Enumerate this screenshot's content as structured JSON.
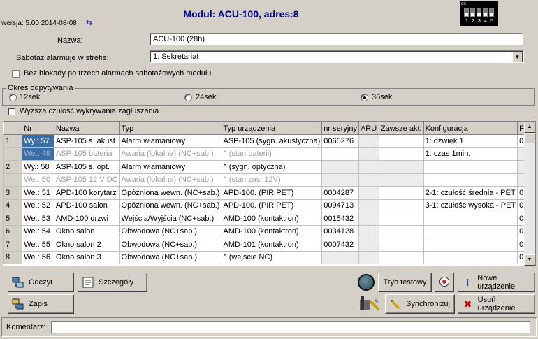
{
  "header": {
    "title": "Moduł: ACU-100, adres:8",
    "version": "wersja: 5.00 2014-08-08",
    "dip_label": "on",
    "dip_numbers": [
      "1",
      "2",
      "3",
      "4",
      "5"
    ]
  },
  "form": {
    "name_label": "Nazwa:",
    "name_value": "ACU-100   (28h)",
    "zone_label": "Sabotaż alarmuje w strefie:",
    "zone_value": "1: Sekretariat",
    "no_block_label": "Bez blokady po trzech alarmach sabotażowych modułu",
    "poll_group_label": "Okres odpytywania",
    "poll_options": [
      "12sek.",
      "24sek.",
      "36sek."
    ],
    "poll_selected": "36sek.",
    "jamming_label": "Wyższa czułość wykrywania zagłuszania"
  },
  "table": {
    "columns": [
      "",
      "Nr",
      "Nazwa",
      "Typ",
      "Typ urządzenia",
      "nr seryjny",
      "ARU",
      "Zawsze akt.",
      "Konfiguracja",
      "Filtr"
    ],
    "rows": [
      {
        "idx": "1",
        "nr": "Wy.: 57",
        "name": "ASP-105 s. akust",
        "type": "Alarm włamaniowy",
        "device": "ASP-105 (sygn. akustyczna)",
        "serial": "0065276",
        "aru": "",
        "always": "",
        "config": "1: dźwięk 1",
        "filter": "0"
      },
      {
        "idx": "",
        "nr": "We.: 49",
        "name": "ASP-105 bateria",
        "type": "Awaria (lokalna) (NC+sab.)",
        "device": "^                (stan baterii)",
        "serial": "",
        "aru": "",
        "always": "",
        "config": "1: czas 1min.",
        "filter": ""
      },
      {
        "idx": "2",
        "nr": "Wy.: 58",
        "name": "ASP-105 s. opt.",
        "type": "Alarm włamaniowy",
        "device": "^              (sygn. optyczna)",
        "serial": "",
        "aru": "",
        "always": "",
        "config": "",
        "filter": ""
      },
      {
        "idx": "",
        "nr": "We.: 50",
        "name": "ASP-105 12 V DC",
        "type": "Awaria (lokalna) (NC+sab.)",
        "device": "^                (stan zas. 12V)",
        "serial": "",
        "aru": "",
        "always": "",
        "config": "",
        "filter": ""
      },
      {
        "idx": "3",
        "nr": "We.: 51",
        "name": "APD-100 korytarz",
        "type": "Opóźniona wewn. (NC+sab.)",
        "device": "APD-100. (PIR PET)",
        "serial": "0004287",
        "aru": "",
        "always": "",
        "config": "2-1: czułość średnia - PET",
        "filter": "0"
      },
      {
        "idx": "4",
        "nr": "We.: 52",
        "name": "APD-100 salon",
        "type": "Opóźniona wewn. (NC+sab.)",
        "device": "APD-100. (PIR PET)",
        "serial": "0094713",
        "aru": "",
        "always": "",
        "config": "3-1: czułość wysoka - PET",
        "filter": "0"
      },
      {
        "idx": "5",
        "nr": "We.: 53",
        "name": "AMD-100 drzwi",
        "type": "Wejścia/Wyjścia (NC+sab.)",
        "device": "AMD-100 (kontaktron)",
        "serial": "0015432",
        "aru": "",
        "always": "",
        "config": "",
        "filter": "0"
      },
      {
        "idx": "6",
        "nr": "We.: 54",
        "name": "Okno salon",
        "type": "Obwodowa (NC+sab.)",
        "device": "AMD-100 (kontaktron)",
        "serial": "0034128",
        "aru": "",
        "always": "",
        "config": "",
        "filter": "0"
      },
      {
        "idx": "7",
        "nr": "We.: 55",
        "name": "Okno salon 2",
        "type": "Obwodowa (NC+sab.)",
        "device": "AMD-101 (kontaktron)",
        "serial": "0007432",
        "aru": "",
        "always": "",
        "config": "",
        "filter": "0"
      },
      {
        "idx": "8",
        "nr": "We.: 56",
        "name": "Okno salon 3",
        "type": "Obwodowa (NC+sab.)",
        "device": "^                (wejście NC)",
        "serial": "",
        "aru": "",
        "always": "",
        "config": "",
        "filter": "0"
      }
    ]
  },
  "buttons": {
    "read": "Odczyt",
    "details": "Szczegóły",
    "write": "Zapis",
    "test_mode": "Tryb testowy",
    "new_device": "Nowe urządzenie",
    "sync": "Synchronizuj",
    "remove_device": "Usuń urządzenie"
  },
  "footer": {
    "comment_label": "Komentarz:",
    "comment_value": ""
  }
}
